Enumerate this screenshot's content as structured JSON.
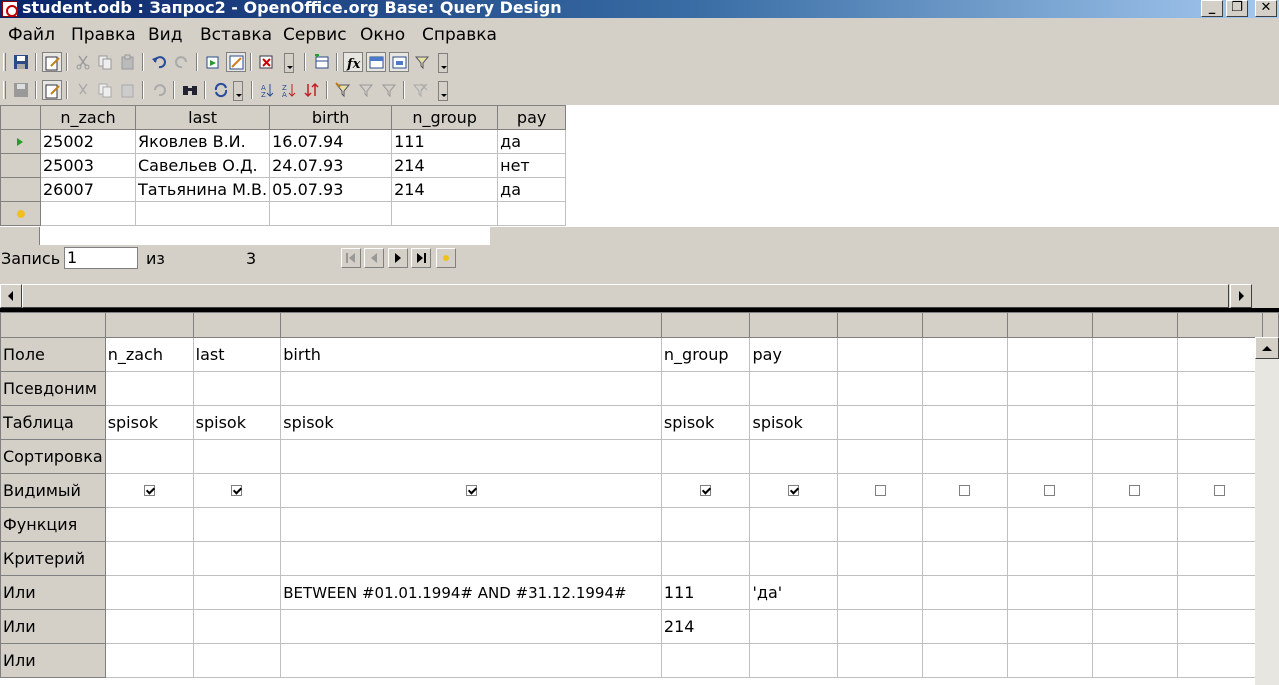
{
  "window": {
    "title": "student.odb : Запрос2 - OpenOffice.org Base: Query Design",
    "btn_min": "_",
    "btn_max": "❐",
    "btn_close": "✕"
  },
  "menu": [
    "Файл",
    "Правка",
    "Вид",
    "Вставка",
    "Сервис",
    "Окно",
    "Справка"
  ],
  "result": {
    "columns": [
      "n_zach",
      "last",
      "birth",
      "n_group",
      "pay"
    ],
    "rows": [
      [
        "25002",
        "Яковлев В.И.",
        "16.07.94",
        "111",
        "да"
      ],
      [
        "25003",
        "Савельев О.Д.",
        "24.07.93",
        "214",
        "нет"
      ],
      [
        "26007",
        "Татьянина М.В.",
        "05.07.93",
        "214",
        "да"
      ]
    ]
  },
  "navigation": {
    "record_label": "Запись",
    "record_value": "1",
    "of_label": "из",
    "total": "3"
  },
  "design": {
    "row_labels": [
      "Поле",
      "Псевдоним",
      "Таблица",
      "Сортировка",
      "Видимый",
      "Функция",
      "Критерий",
      "Или",
      "Или",
      "Или"
    ],
    "columns": [
      {
        "field": "n_zach",
        "table": "spisok",
        "visible": true,
        "criteria": "",
        "or1": "",
        "or2": ""
      },
      {
        "field": "last",
        "table": "spisok",
        "visible": true,
        "criteria": "",
        "or1": "",
        "or2": ""
      },
      {
        "field": "birth",
        "table": "spisok",
        "visible": true,
        "criteria": "",
        "or1": "BETWEEN #01.01.1994# AND #31.12.1994#",
        "or2": ""
      },
      {
        "field": "n_group",
        "table": "spisok",
        "visible": true,
        "criteria": "",
        "or1": "111",
        "or2": "214"
      },
      {
        "field": "pay",
        "table": "spisok",
        "visible": true,
        "criteria": "",
        "or1": "'да'",
        "or2": ""
      },
      {
        "field": "",
        "table": "",
        "visible": false,
        "criteria": "",
        "or1": "",
        "or2": ""
      },
      {
        "field": "",
        "table": "",
        "visible": false,
        "criteria": "",
        "or1": "",
        "or2": ""
      },
      {
        "field": "",
        "table": "",
        "visible": false,
        "criteria": "",
        "or1": "",
        "or2": ""
      },
      {
        "field": "",
        "table": "",
        "visible": false,
        "criteria": "",
        "or1": "",
        "or2": ""
      },
      {
        "field": "",
        "table": "",
        "visible": false,
        "criteria": "",
        "or1": "",
        "or2": ""
      }
    ]
  }
}
